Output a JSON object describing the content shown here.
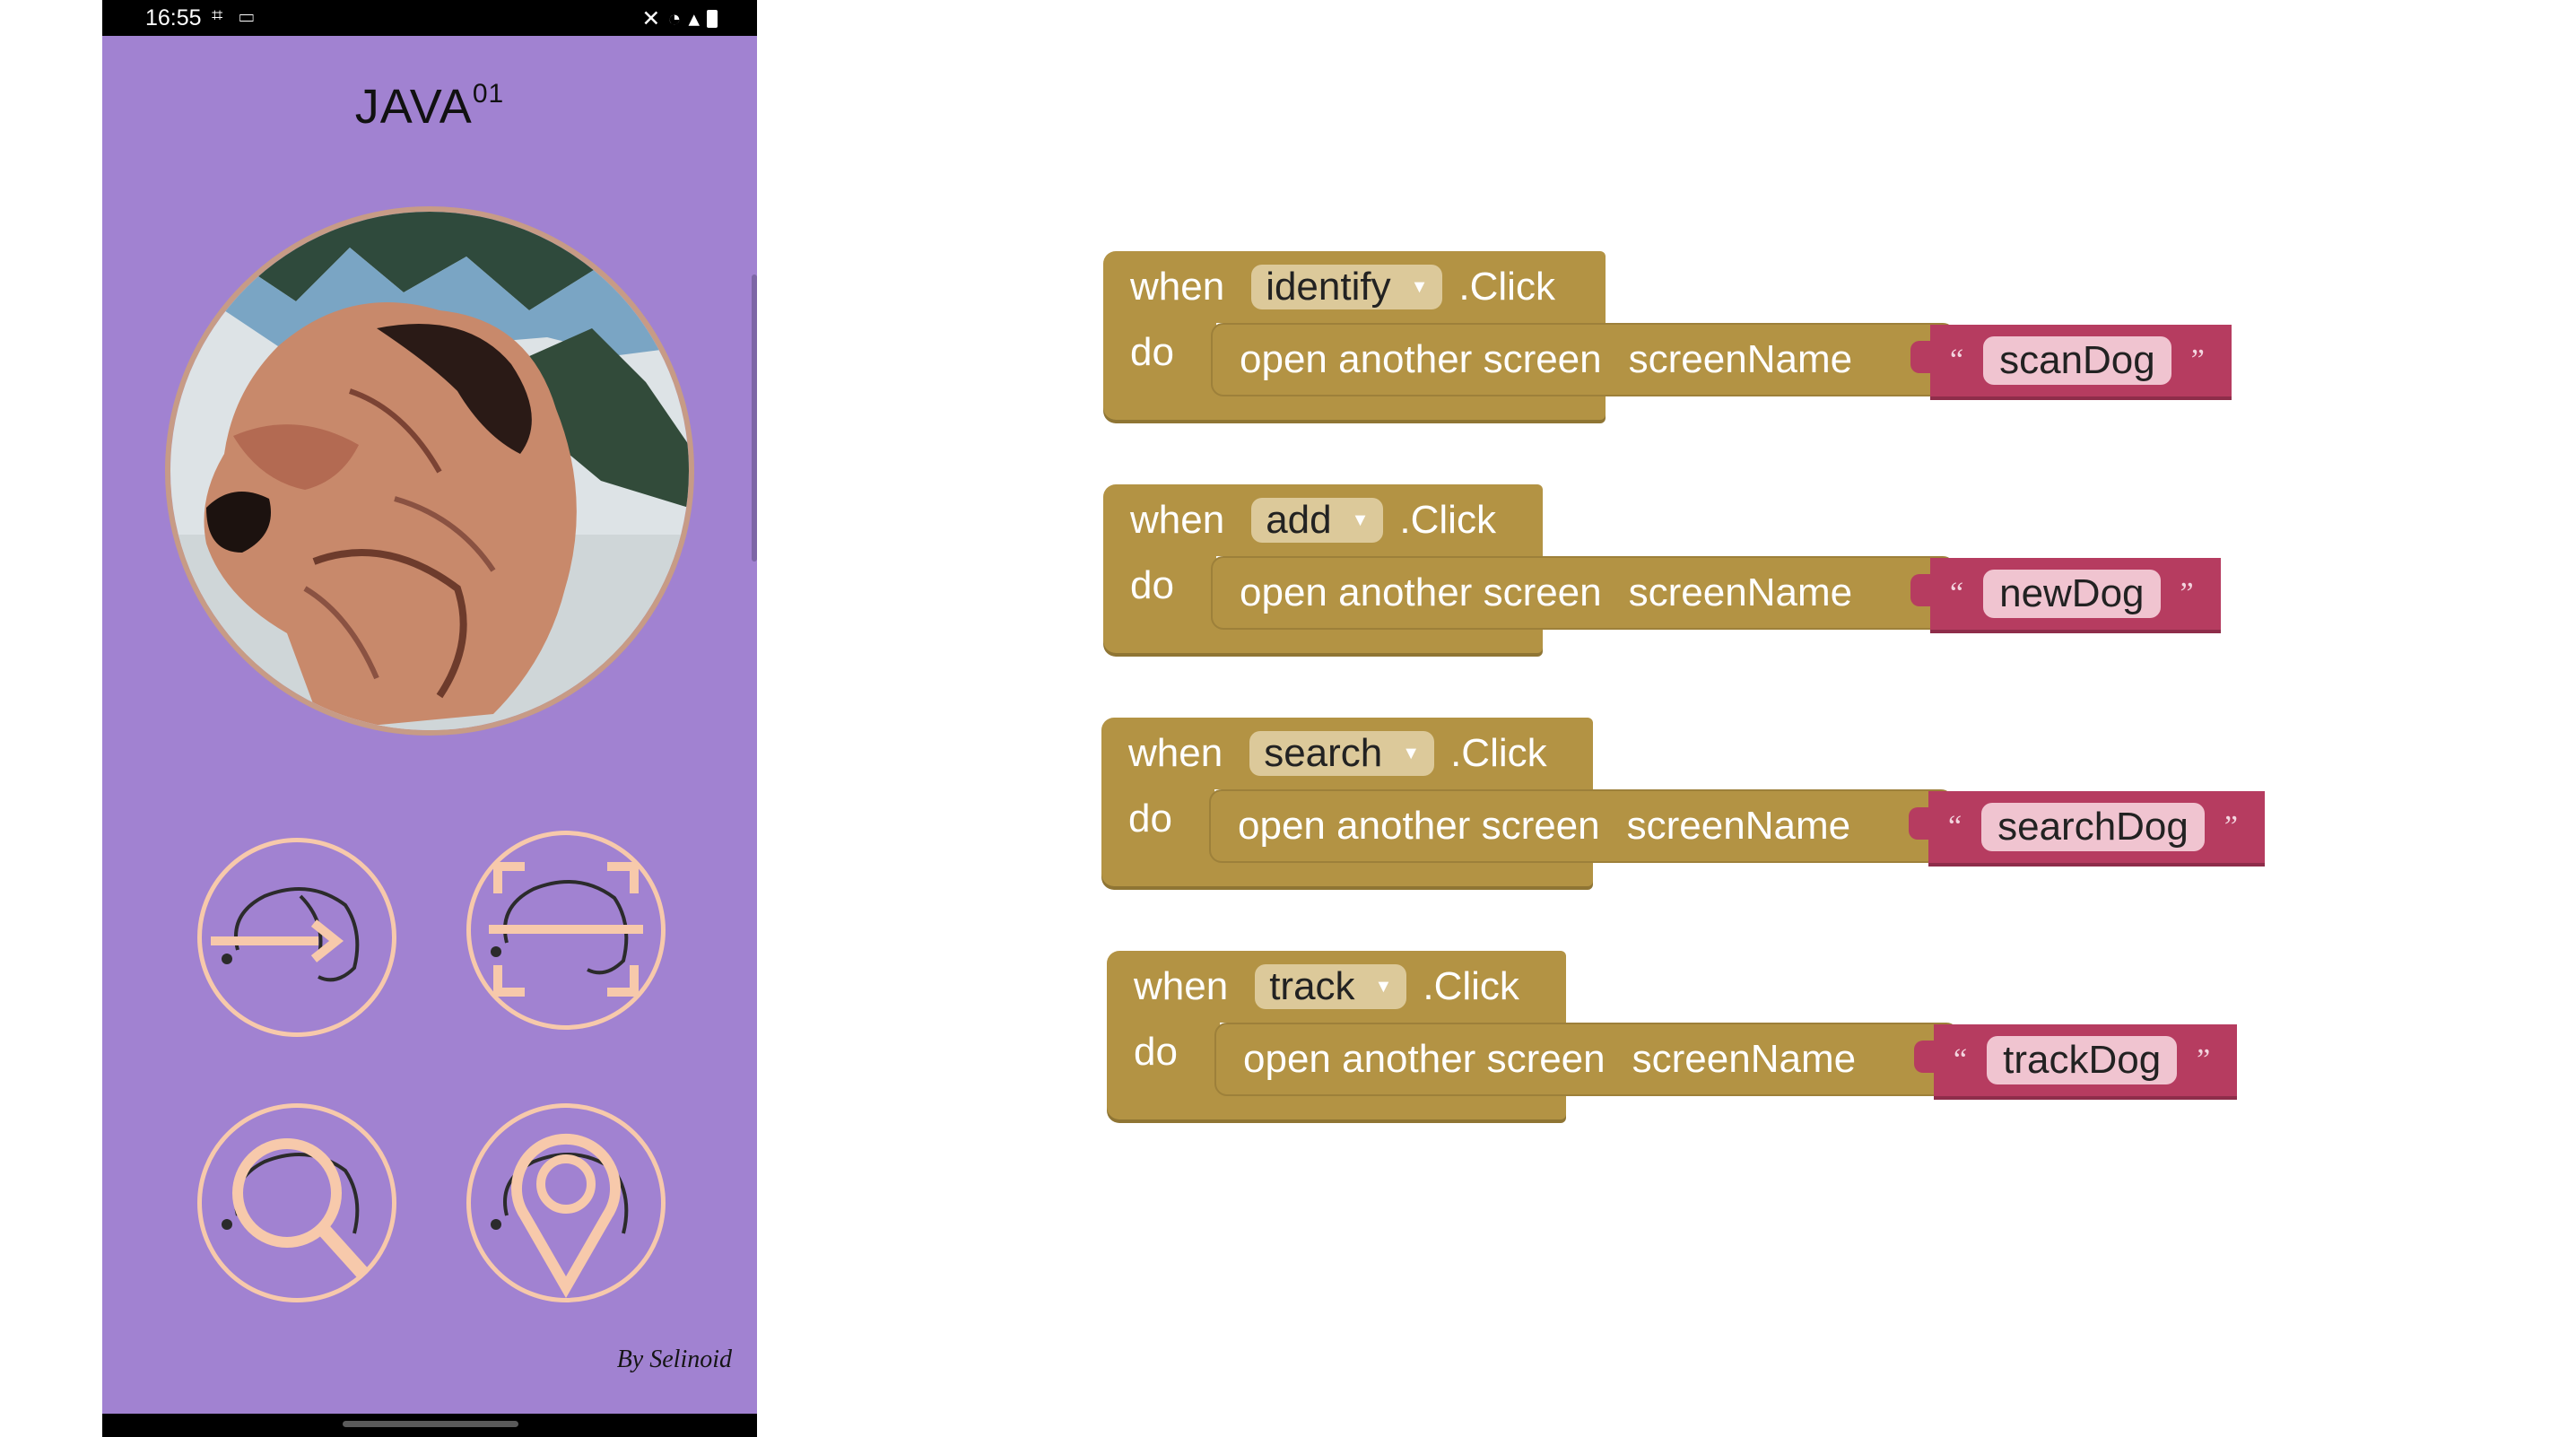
{
  "status_bar": {
    "time": "16:55"
  },
  "app": {
    "title": "JAVA",
    "title_superscript": "01",
    "credit": "By Selinoid"
  },
  "icon_buttons": [
    {
      "name": "identify",
      "icon": "dog-arrow-icon"
    },
    {
      "name": "scan",
      "icon": "dog-scan-frame-icon"
    },
    {
      "name": "search",
      "icon": "dog-magnifier-icon"
    },
    {
      "name": "track",
      "icon": "dog-location-pin-icon"
    }
  ],
  "colors": {
    "phone_background": "#a182d1",
    "event_block": "#b39344",
    "text_block": "#b63c60",
    "icon_stroke": "#f7c9ab"
  },
  "blocks": [
    {
      "when": "when",
      "component": "identify",
      "event": ".Click",
      "do": "do",
      "call": "open another screen",
      "param": "screenName",
      "open_quote": "“",
      "value": "scanDog",
      "close_quote": "”"
    },
    {
      "when": "when",
      "component": "add",
      "event": ".Click",
      "do": "do",
      "call": "open another screen",
      "param": "screenName",
      "open_quote": "“",
      "value": "newDog",
      "close_quote": "”"
    },
    {
      "when": "when",
      "component": "search",
      "event": ".Click",
      "do": "do",
      "call": "open another screen",
      "param": "screenName",
      "open_quote": "“",
      "value": "searchDog",
      "close_quote": "”"
    },
    {
      "when": "when",
      "component": "track",
      "event": ".Click",
      "do": "do",
      "call": "open another screen",
      "param": "screenName",
      "open_quote": "“",
      "value": "trackDog",
      "close_quote": "”"
    }
  ]
}
